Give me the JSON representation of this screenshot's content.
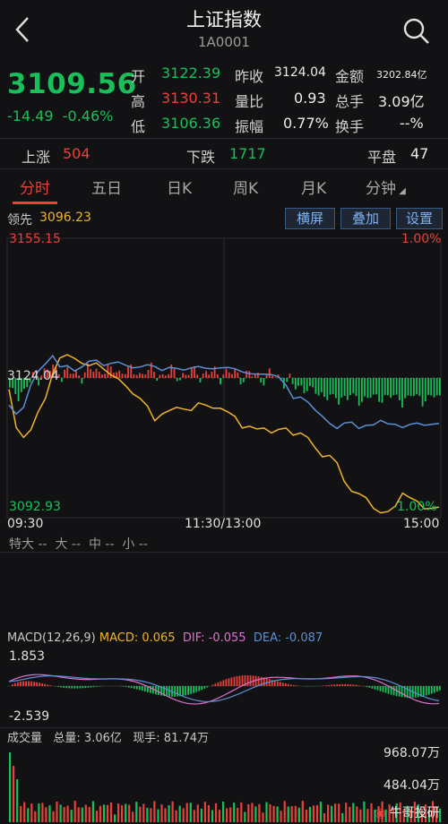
{
  "header": {
    "title": "上证指数",
    "code": "1A0001"
  },
  "quote": {
    "price": "3109.56",
    "change": "-14.49",
    "change_pct": "-0.46%",
    "open_label": "开",
    "open": "3122.39",
    "high_label": "高",
    "high": "3130.31",
    "low_label": "低",
    "low": "3106.36",
    "prevclose_label": "昨收",
    "prevclose": "3124.04",
    "volratio_label": "量比",
    "volratio": "0.93",
    "amplitude_label": "振幅",
    "amplitude": "0.77%",
    "amount_label": "金额",
    "amount": "3202.84亿",
    "totalvol_label": "总手",
    "totalvol": "3.09亿",
    "turnover_label": "换手",
    "turnover": "--%"
  },
  "breadth": {
    "up_label": "上涨",
    "up": "504",
    "down_label": "下跌",
    "down": "1717",
    "flat_label": "平盘",
    "flat": "47"
  },
  "tabs": [
    "分时",
    "五日",
    "日K",
    "周K",
    "月K",
    "分钟"
  ],
  "toolbar": {
    "leader_label": "领先",
    "leader_value": "3096.23",
    "btn_landscape": "横屏",
    "btn_overlay": "叠加",
    "btn_settings": "设置"
  },
  "chart_data": {
    "type": "line",
    "x_labels": [
      "09:30",
      "11:30/13:00",
      "15:00"
    ],
    "ylim": [
      3092.93,
      3155.15
    ],
    "y_top": "3155.15",
    "y_mid": "3124.04",
    "y_bottom": "3092.93",
    "pct_top": "1.00%",
    "pct_bottom": "-1.00%",
    "colors": {
      "index_line": "#f0b429",
      "leader_line": "#5b8fd6",
      "up": "#e8403a",
      "down": "#19c05a"
    },
    "series": [
      {
        "values": [
          3121.5,
          3113,
          3110.8,
          3112.5,
          3116.5,
          3119.5,
          3125,
          3128.5,
          3129.2,
          3128.4,
          3127.3,
          3126.8,
          3127.4,
          3126,
          3124.7,
          3123.9,
          3122.3,
          3120.5,
          3119.5,
          3117.8,
          3114.5,
          3116,
          3116.8,
          3117.5,
          3117.1,
          3116.8,
          3118.5,
          3118,
          3117.3,
          3117.3,
          3116.5,
          3115.5,
          3112.9,
          3113.3,
          3112.7,
          3112.9,
          3111.8,
          3112.6,
          3112.9,
          3111.3,
          3111.8,
          3110.8,
          3108.5,
          3106.5,
          3106.8,
          3105.2,
          3101,
          3098.8,
          3098.3,
          3097.4,
          3095,
          3094,
          3094.3,
          3095.5,
          3098.4,
          3097.4,
          3096.6,
          3094.9,
          3095,
          3095.3
        ]
      },
      {
        "values": [
          3118,
          3116,
          3117.5,
          3122.5,
          3125.5,
          3127.2,
          3129,
          3126.5,
          3126.8,
          3125.6,
          3126.5,
          3127.8,
          3128,
          3126.8,
          3127.3,
          3127.6,
          3126.9,
          3126.3,
          3126.5,
          3127,
          3126.6,
          3125.7,
          3126.4,
          3126.2,
          3125.8,
          3126.3,
          3126.6,
          3126.2,
          3126.1,
          3126.3,
          3126.4,
          3126.1,
          3125.4,
          3125,
          3124.9,
          3124.9,
          3124.8,
          3124.3,
          3122.4,
          3119.5,
          3119.8,
          3118.7,
          3116.9,
          3115.5,
          3113.9,
          3112.8,
          3114,
          3114.2,
          3112.8,
          3113.5,
          3113.6,
          3114.6,
          3113.8,
          3113.7,
          3113,
          3113.7,
          3114,
          3113.5,
          3113.7,
          3113.9
        ]
      }
    ]
  },
  "tick_stats": {
    "big": "特大 --",
    "large": "大 --",
    "mid": "中 --",
    "small": "小 --"
  },
  "macd": {
    "params": "MACD(12,26,9)",
    "macd": "MACD: 0.065",
    "dif": "DIF: -0.055",
    "dea": "DEA: -0.087",
    "y_top": "1.853",
    "y_bottom": "-2.539",
    "colors": {
      "macd": "#f0b429",
      "dif": "#e070d0",
      "dea": "#5b8fd6"
    }
  },
  "volume": {
    "title": "成交量",
    "total": "总量: 3.06亿",
    "now": "现手: 81.74万",
    "y_top": "968.07万",
    "y_mid": "484.04万"
  },
  "watermark": "牛哥投研"
}
